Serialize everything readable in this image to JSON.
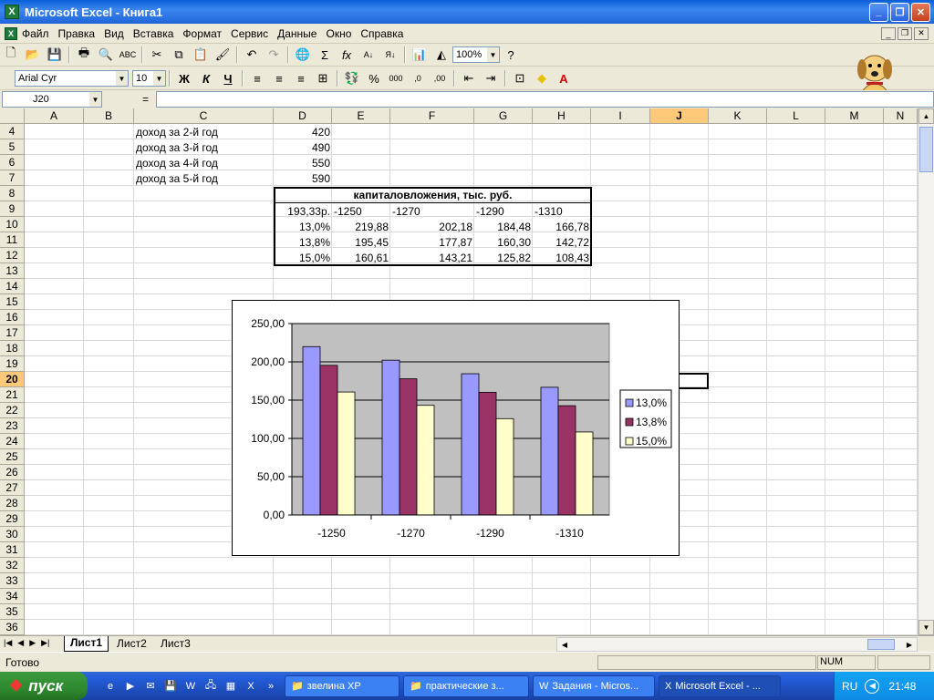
{
  "window": {
    "title": "Microsoft Excel - Книга1"
  },
  "menu": [
    "Файл",
    "Правка",
    "Вид",
    "Вставка",
    "Формат",
    "Сервис",
    "Данные",
    "Окно",
    "Справка"
  ],
  "toolbar": {
    "zoom": "100%"
  },
  "format_bar": {
    "font": "Arial Cyr",
    "size": "10",
    "bold": "Ж",
    "italic": "К",
    "underline": "Ч"
  },
  "formula_bar": {
    "namebox": "J20",
    "equals": "=",
    "value": ""
  },
  "columns": [
    "A",
    "B",
    "C",
    "D",
    "E",
    "F",
    "G",
    "H",
    "I",
    "J",
    "K",
    "L",
    "M",
    "N"
  ],
  "selected_col": "J",
  "rows": [
    "4",
    "5",
    "6",
    "7",
    "8",
    "9",
    "10",
    "11",
    "12",
    "13",
    "14",
    "15",
    "16",
    "17",
    "18",
    "19",
    "20",
    "21",
    "22",
    "23",
    "24",
    "25",
    "26",
    "27",
    "28",
    "29",
    "30",
    "31",
    "32",
    "33",
    "34",
    "35",
    "36"
  ],
  "selected_row": "20",
  "cells": {
    "c4": "доход за 2-й год",
    "d4": "420",
    "c5": "доход за 3-й год",
    "d5": "490",
    "c6": "доход за 4-й год",
    "d6": "550",
    "c7": "доход за 5-й год",
    "d7": "590",
    "table_title": "капиталовложения, тыс. руб.",
    "d9": "193,33р.",
    "e9": "-1250",
    "f9": "-1270",
    "g9": "-1290",
    "h9": "-1310",
    "d10": "13,0%",
    "e10": "219,88",
    "f10": "202,18",
    "g10": "184,48",
    "h10": "166,78",
    "d11": "13,8%",
    "e11": "195,45",
    "f11": "177,87",
    "g11": "160,30",
    "h11": "142,72",
    "d12": "15,0%",
    "e12": "160,61",
    "f12": "143,21",
    "g12": "125,82",
    "h12": "108,43"
  },
  "chart_data": {
    "type": "bar",
    "categories": [
      "-1250",
      "-1270",
      "-1290",
      "-1310"
    ],
    "series": [
      {
        "name": "13,0%",
        "values": [
          219.88,
          202.18,
          184.48,
          166.78
        ],
        "color": "#9999ff"
      },
      {
        "name": "13,8%",
        "values": [
          195.45,
          177.87,
          160.3,
          142.72
        ],
        "color": "#993366"
      },
      {
        "name": "15,0%",
        "values": [
          160.61,
          143.21,
          125.82,
          108.43
        ],
        "color": "#ffffcc"
      }
    ],
    "yticks": [
      "0,00",
      "50,00",
      "100,00",
      "150,00",
      "200,00",
      "250,00"
    ],
    "ylim": [
      0,
      250
    ],
    "grid": true,
    "plot_bg": "#c0c0c0",
    "legend": "right"
  },
  "sheets": [
    "Лист1",
    "Лист2",
    "Лист3"
  ],
  "active_sheet": "Лист1",
  "status": {
    "ready": "Готово",
    "num": "NUM"
  },
  "taskbar": {
    "start": "пуск",
    "tasks": [
      "звелина  XP",
      "практические з...",
      "Задания - Micros...",
      "Microsoft Excel - ..."
    ],
    "lang": "RU",
    "time": "21:48"
  }
}
